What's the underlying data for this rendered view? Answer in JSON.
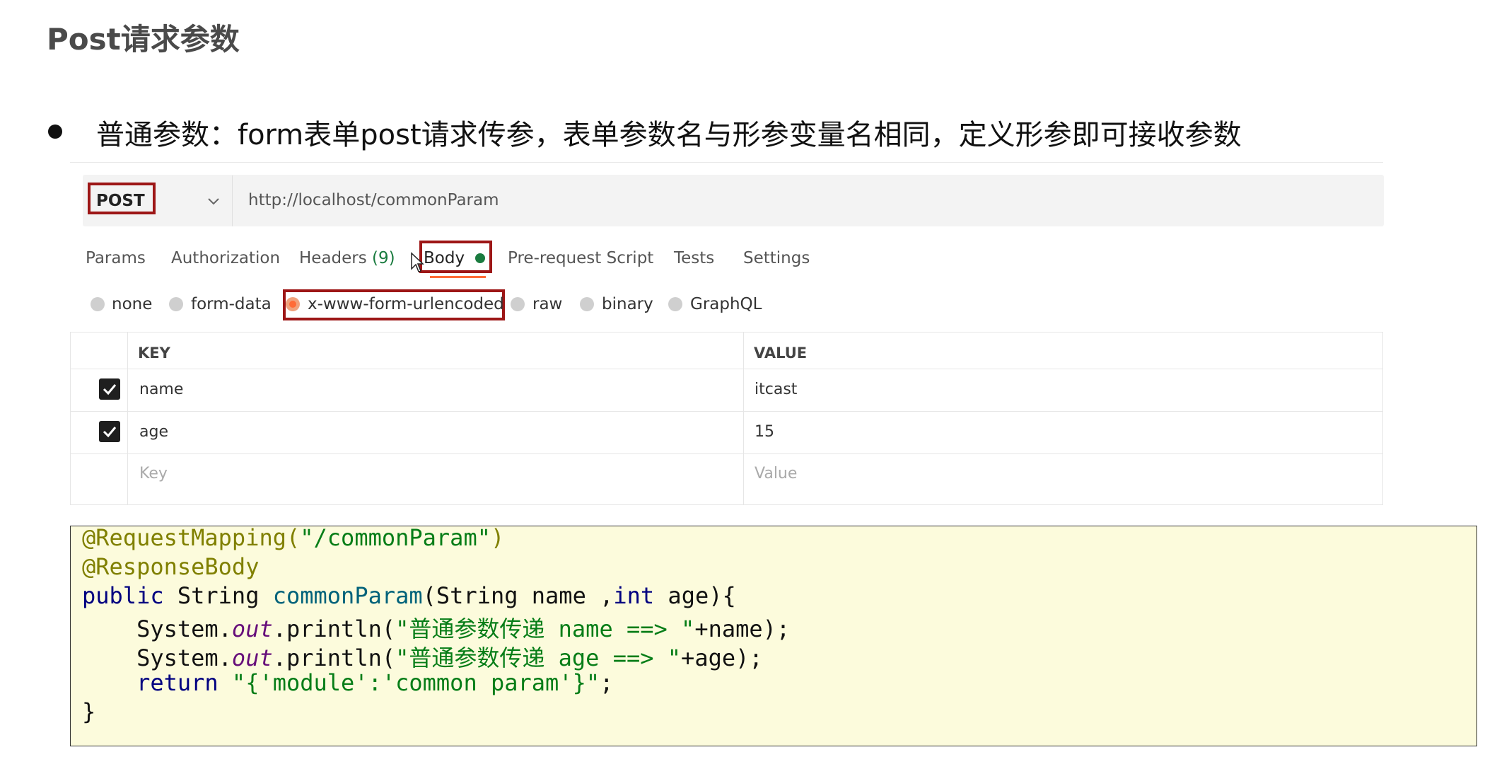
{
  "title": "Post请求参数",
  "bullet": "普通参数：form表单post请求传参，表单参数名与形参变量名相同，定义形参即可接收参数",
  "request": {
    "method": "POST",
    "url": "http://localhost/commonParam"
  },
  "tabs": {
    "params": "Params",
    "authorization": "Authorization",
    "headers": "Headers",
    "headers_count": "(9)",
    "body": "Body",
    "pre_request": "Pre-request Script",
    "tests": "Tests",
    "settings": "Settings",
    "active": "Body"
  },
  "body_types": {
    "none": "none",
    "form_data": "form-data",
    "urlencoded": "x-www-form-urlencoded",
    "raw": "raw",
    "binary": "binary",
    "graphql": "GraphQL",
    "selected": "x-www-form-urlencoded"
  },
  "table": {
    "key_header": "KEY",
    "value_header": "VALUE",
    "rows": [
      {
        "key": "name",
        "value": "itcast",
        "checked": true
      },
      {
        "key": "age",
        "value": "15",
        "checked": true
      }
    ],
    "key_placeholder": "Key",
    "value_placeholder": "Value"
  },
  "code": {
    "l1_ann": "@RequestMapping(",
    "l1_str": "\"/commonParam\"",
    "l1_end": ")",
    "l2_ann": "@ResponseBody",
    "l3_kw": "public",
    "l3_type": " String ",
    "l3_method": "commonParam",
    "l3_params_a": "(String name ,",
    "l3_int": "int",
    "l3_params_b": " age){",
    "l4_a": "    System.",
    "l4_out": "out",
    "l4_b": ".println(",
    "l4_str": "\"普通参数传递 name ==> \"",
    "l4_c": "+name);",
    "l5_a": "    System.",
    "l5_out": "out",
    "l5_b": ".println(",
    "l5_str": "\"普通参数传递 age ==> \"",
    "l5_c": "+age);",
    "l6_kw": "    return ",
    "l6_str": "\"{'module':'common param'}\"",
    "l6_end": ";",
    "l7": "}"
  },
  "colors": {
    "highlight_border": "#9d1616",
    "active_tab_underline": "#ff6c37",
    "body_indicator": "#1a7b3f",
    "code_background": "#fcfbdc"
  }
}
